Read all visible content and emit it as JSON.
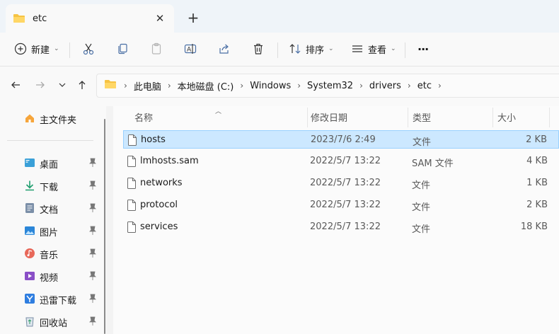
{
  "window": {
    "tab_title": "etc",
    "new_tab_glyph": "+",
    "close_glyph": "✕"
  },
  "toolbar": {
    "new_label": "新建",
    "sort_label": "排序",
    "view_label": "查看",
    "more_glyph": "···"
  },
  "breadcrumb": {
    "items": [
      "此电脑",
      "本地磁盘 (C:)",
      "Windows",
      "System32",
      "drivers",
      "etc"
    ]
  },
  "sidebar": {
    "home": "主文件夹",
    "items": [
      {
        "label": "桌面",
        "icon": "desktop-icon"
      },
      {
        "label": "下载",
        "icon": "download-icon"
      },
      {
        "label": "文档",
        "icon": "document-icon"
      },
      {
        "label": "图片",
        "icon": "pictures-icon"
      },
      {
        "label": "音乐",
        "icon": "music-icon"
      },
      {
        "label": "视频",
        "icon": "video-icon"
      },
      {
        "label": "迅雷下载",
        "icon": "xunlei-icon"
      },
      {
        "label": "回收站",
        "icon": "recycle-bin-icon"
      }
    ]
  },
  "columns": {
    "name": "名称",
    "modified": "修改日期",
    "type": "类型",
    "size": "大小"
  },
  "files": [
    {
      "name": "hosts",
      "modified": "2023/7/6 2:49",
      "type": "文件",
      "size": "2 KB",
      "selected": true
    },
    {
      "name": "lmhosts.sam",
      "modified": "2022/5/7 13:22",
      "type": "SAM 文件",
      "size": "4 KB",
      "selected": false
    },
    {
      "name": "networks",
      "modified": "2022/5/7 13:22",
      "type": "文件",
      "size": "1 KB",
      "selected": false
    },
    {
      "name": "protocol",
      "modified": "2022/5/7 13:22",
      "type": "文件",
      "size": "2 KB",
      "selected": false
    },
    {
      "name": "services",
      "modified": "2022/5/7 13:22",
      "type": "文件",
      "size": "18 KB",
      "selected": false
    }
  ],
  "colors": {
    "selection_bg": "#cce8ff",
    "selection_border": "#99d1ff",
    "folder": "#f6c343"
  }
}
